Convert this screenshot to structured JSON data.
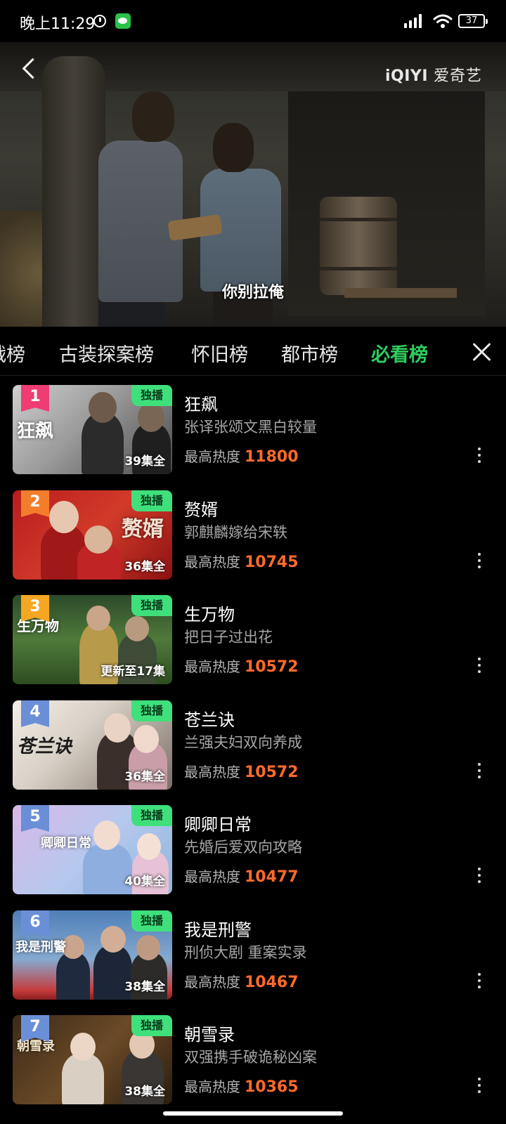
{
  "status_bar": {
    "time": "晚上11:29",
    "battery": "37"
  },
  "player": {
    "subtitle": "你别拉俺",
    "logo": {
      "brand": "iQIYI",
      "name": "爱奇艺"
    }
  },
  "tabs": {
    "items": [
      {
        "label": "战榜"
      },
      {
        "label": "古装探案榜"
      },
      {
        "label": "怀旧榜"
      },
      {
        "label": "都市榜"
      },
      {
        "label": "必看榜"
      }
    ],
    "active_index": 4,
    "accent_color": "#2ecc5f"
  },
  "list": {
    "heat_label": "最高热度",
    "exclusive_label": "独播",
    "items": [
      {
        "rank": "1",
        "title": "狂飙",
        "desc": "张译张颂文黑白较量",
        "heat": "11800",
        "episodes": "39集全",
        "poster_text": "狂飙",
        "rank_color": "#ef3d73"
      },
      {
        "rank": "2",
        "title": "赘婿",
        "desc": "郭麒麟嫁给宋轶",
        "heat": "10745",
        "episodes": "36集全",
        "poster_text": "赘婿",
        "rank_color": "#f47d2c"
      },
      {
        "rank": "3",
        "title": "生万物",
        "desc": "把日子过出花",
        "heat": "10572",
        "episodes": "更新至17集",
        "poster_text": "生万物",
        "rank_color": "#f5a623"
      },
      {
        "rank": "4",
        "title": "苍兰诀",
        "desc": "兰强夫妇双向养成",
        "heat": "10572",
        "episodes": "36集全",
        "poster_text": "苍兰诀",
        "rank_color": "#6b8fd6"
      },
      {
        "rank": "5",
        "title": "卿卿日常",
        "desc": "先婚后爱双向攻略",
        "heat": "10477",
        "episodes": "40集全",
        "poster_text": "卿卿日常",
        "rank_color": "#6b8fd6"
      },
      {
        "rank": "6",
        "title": "我是刑警",
        "desc": "刑侦大剧 重案实录",
        "heat": "10467",
        "episodes": "38集全",
        "poster_text": "我是刑警",
        "rank_color": "#6b8fd6"
      },
      {
        "rank": "7",
        "title": "朝雪录",
        "desc": "双强携手破诡秘凶案",
        "heat": "10365",
        "episodes": "38集全",
        "poster_text": "朝雪录",
        "rank_color": "#6b8fd6"
      }
    ]
  },
  "colors": {
    "heat": "#ff6a2b",
    "exclusive_badge": "#3fe07c",
    "background": "#000000"
  }
}
